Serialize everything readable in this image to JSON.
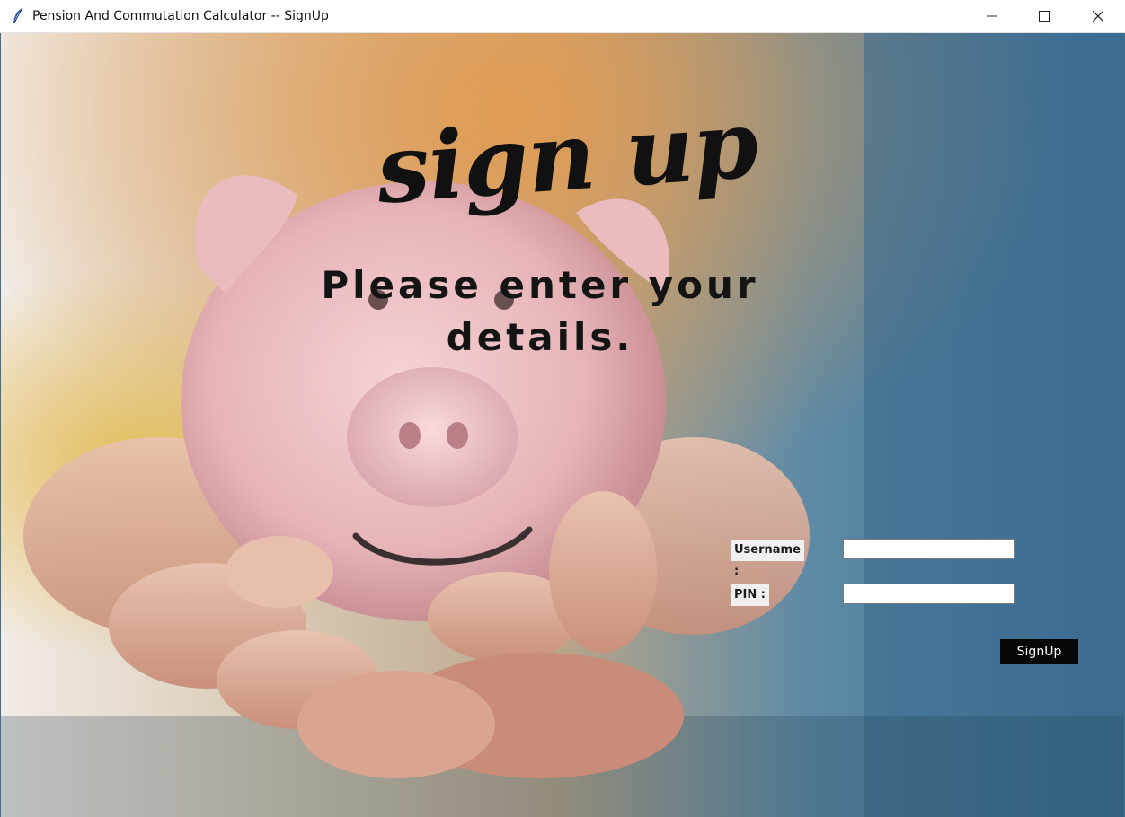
{
  "window": {
    "title": "Pension And Commutation Calculator -- SignUp",
    "app_icon": "feather-icon",
    "controls": [
      "minimize-icon",
      "maximize-icon",
      "close-icon"
    ]
  },
  "background": {
    "description_icon": "piggy-bank-in-hands-photo"
  },
  "heading": "sign up",
  "subheading_line1": "Please enter your",
  "subheading_line2": "details.",
  "form": {
    "username_label": "Username :",
    "username_value": "",
    "pin_label": "PIN  :",
    "pin_value": "",
    "submit_label": "SignUp"
  },
  "colors": {
    "titlebar": "#ffffff",
    "button": "#060606",
    "button_text": "#ffffff",
    "label_bg": "#f0f0f0"
  }
}
